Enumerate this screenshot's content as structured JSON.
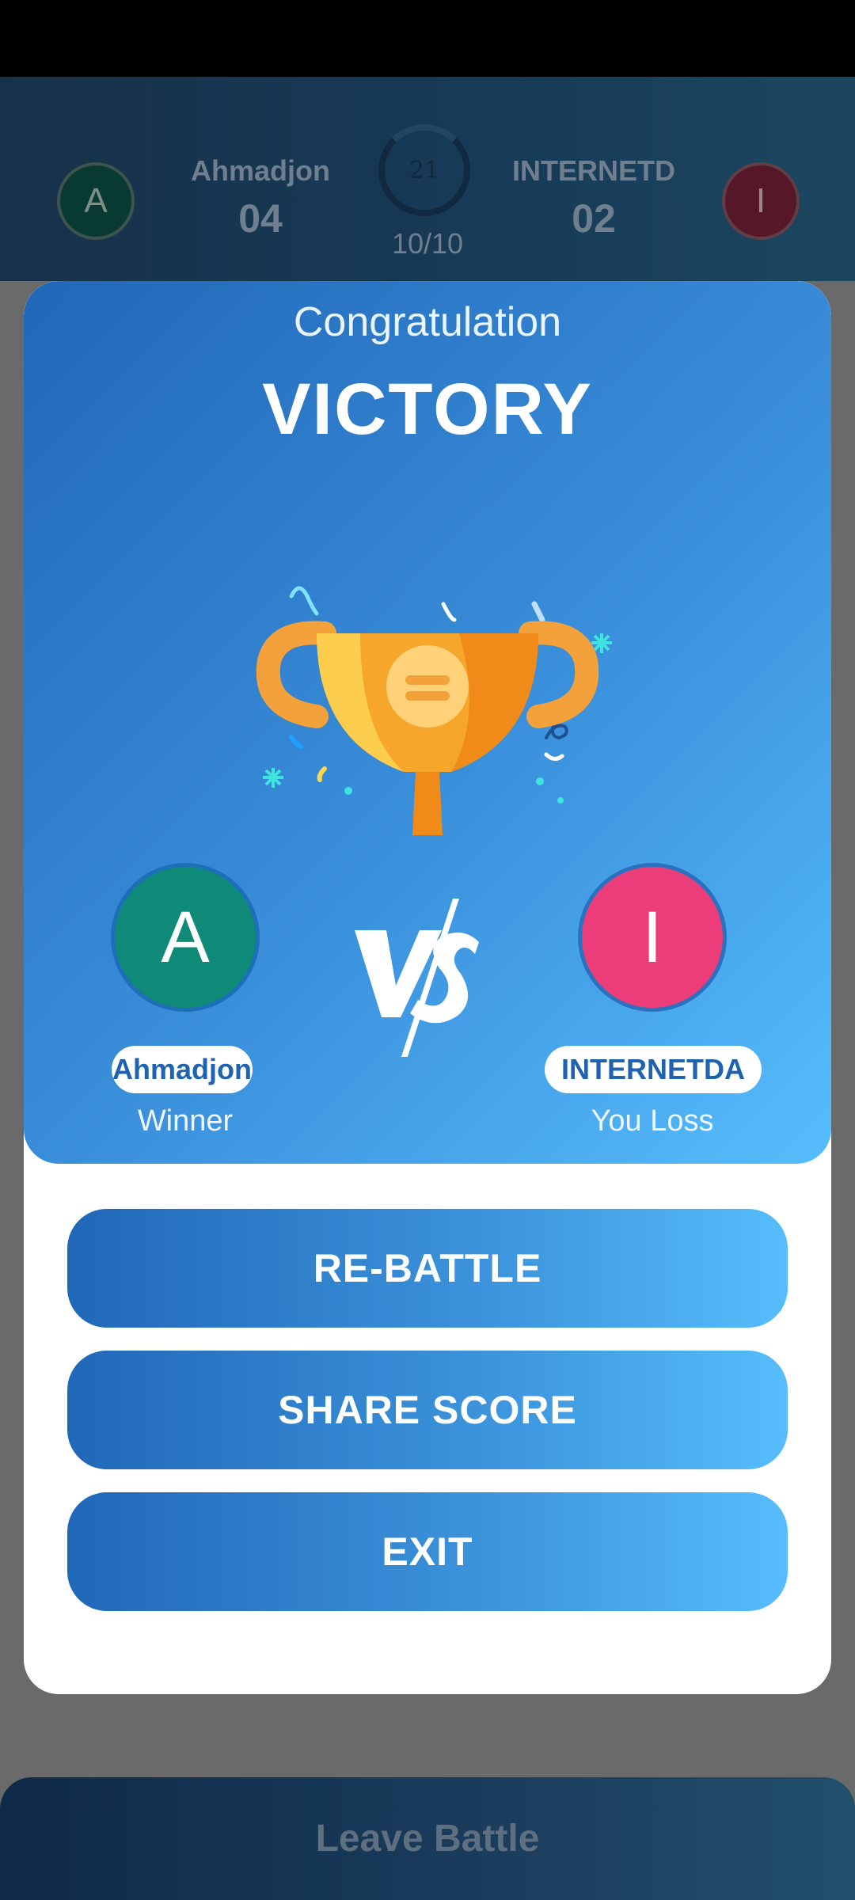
{
  "scoreboard": {
    "player_left": {
      "initial": "A",
      "name": "Ahmadjon",
      "score": "04"
    },
    "player_right": {
      "initial": "I",
      "name": "INTERNETD",
      "score": "02"
    },
    "timer": "21",
    "progress": "10/10"
  },
  "dialog": {
    "congrats": "Congratulation",
    "title": "VICTORY",
    "winner": {
      "initial": "A",
      "name": "Ahmadjon",
      "status": "Winner"
    },
    "loser": {
      "initial": "I",
      "name": "INTERNETDA",
      "status": "You Loss"
    },
    "buttons": {
      "rebattle": "RE-BATTLE",
      "share": "SHARE SCORE",
      "exit": "EXIT"
    }
  },
  "footer": {
    "leave_label": "Leave Battle"
  },
  "colors": {
    "accent_start": "#2167b8",
    "accent_end": "#56bdfc",
    "winner_avatar": "#0f8a78",
    "loser_avatar": "#eb3d79"
  }
}
